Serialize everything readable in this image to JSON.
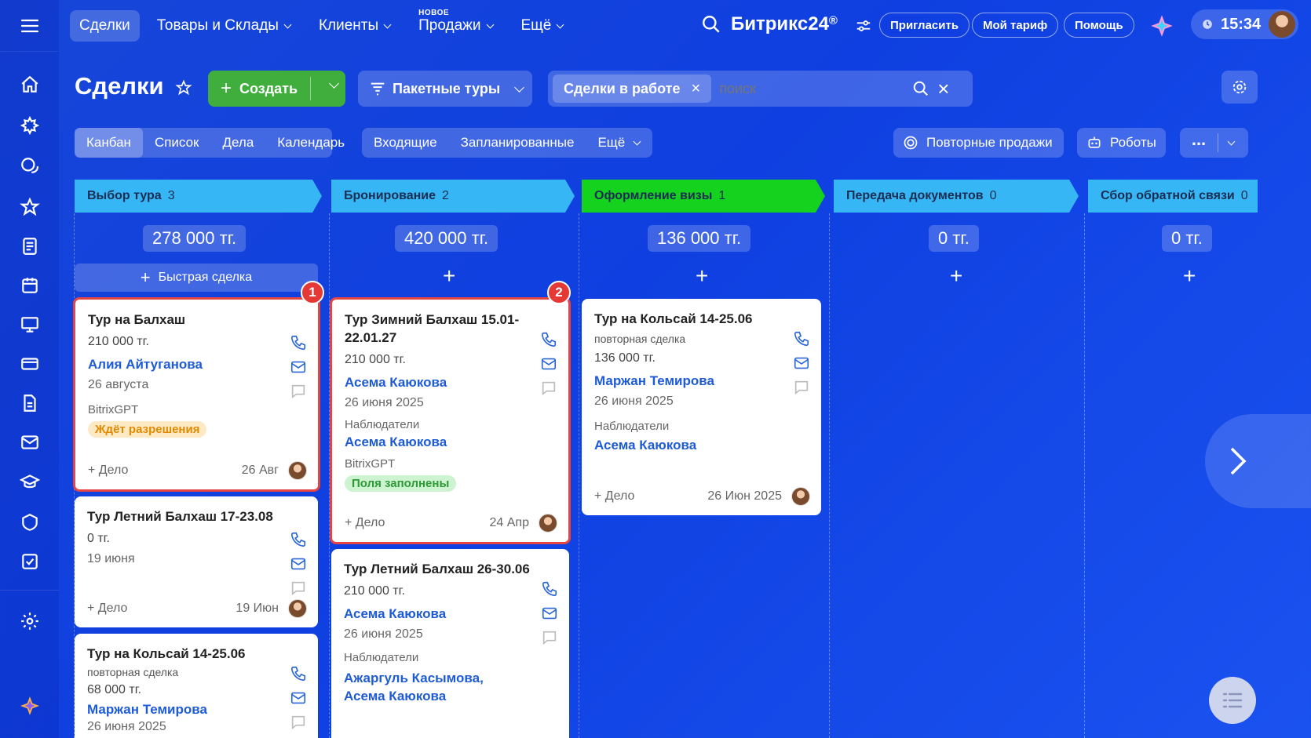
{
  "nav": {
    "items": [
      {
        "label": "Сделки",
        "active": true
      },
      {
        "label": "Товары и Склады",
        "dropdown": true
      },
      {
        "label": "Клиенты",
        "dropdown": true
      },
      {
        "label": "Продажи",
        "dropdown": true,
        "badge": "НОВОЕ"
      },
      {
        "label": "Ещё",
        "dropdown": true
      }
    ],
    "logo": "Битрикс24",
    "logo_mark": "®",
    "invite": "Пригласить",
    "plan": "Мой тариф",
    "help": "Помощь",
    "time": "15:34"
  },
  "header": {
    "title": "Сделки",
    "create": "Создать",
    "pipeline": "Пакетные туры",
    "filter_chip": "Сделки в работе",
    "search_placeholder": "поиск"
  },
  "views": {
    "tabs": [
      "Канбан",
      "Список",
      "Дела",
      "Календарь"
    ],
    "groups": [
      "Входящие",
      "Запланированные",
      "Ещё"
    ],
    "repeat_sales": "Повторные продажи",
    "robots": "Роботы"
  },
  "columns": [
    {
      "title": "Выбор тура",
      "count": "3",
      "sum": "278 000 тг.",
      "color": "#37b6f5"
    },
    {
      "title": "Бронирование",
      "count": "2",
      "sum": "420 000 тг.",
      "color": "#37b6f5"
    },
    {
      "title": "Оформление визы",
      "count": "1",
      "sum": "136 000 тг.",
      "color": "#14d21e"
    },
    {
      "title": "Передача документов",
      "count": "0",
      "sum": "0 тг.",
      "color": "#37b6f5"
    },
    {
      "title": "Сбор обратной связи",
      "count": "0",
      "sum": "0 тг.",
      "color": "#37b6f5"
    }
  ],
  "quick_deal": "Быстрая сделка",
  "cards": {
    "c1": {
      "title": "Тур на Балхаш",
      "amount": "210 000 тг.",
      "contact": "Алия Айтуганова",
      "date": "26 августа",
      "gpt": "BitrixGPT",
      "badge": "Ждёт разрешения",
      "action": "+ Дело",
      "foot_date": "26 Авг",
      "marker": "1"
    },
    "c2": {
      "title": "Тур Летний Балхаш 17-23.08",
      "amount": "0 тг.",
      "date": "19 июня",
      "action": "+ Дело",
      "foot_date": "19 Июн"
    },
    "c3": {
      "title": "Тур на Кольсай 14-25.06",
      "sub": "повторная сделка",
      "amount": "68 000 тг.",
      "contact": "Маржан Темирова",
      "date": "26 июня 2025"
    },
    "c4": {
      "title": "Тур Зимний Балхаш 15.01-22.01.27",
      "amount": "210 000 тг.",
      "contact": "Асема Каюкова",
      "date": "26 июня 2025",
      "observers": "Наблюдатели",
      "observer": "Асема Каюкова",
      "gpt": "BitrixGPT",
      "badge": "Поля заполнены",
      "action": "+ Дело",
      "foot_date": "24 Апр",
      "marker": "2"
    },
    "c5": {
      "title": "Тур Летний Балхаш 26-30.06",
      "amount": "210 000 тг.",
      "contact": "Асема Каюкова",
      "date": "26 июня 2025",
      "observers": "Наблюдатели",
      "observer1": "Ажаргуль Касымова,",
      "observer2": "Асема Каюкова"
    },
    "c6": {
      "title": "Тур на Кольсай 14-25.06",
      "sub": "повторная сделка",
      "amount": "136 000 тг.",
      "contact": "Маржан Темирова",
      "date": "26 июня 2025",
      "observers": "Наблюдатели",
      "observer": "Асема Каюкова",
      "action": "+ Дело",
      "foot_date": "26 Июн 2025"
    }
  }
}
